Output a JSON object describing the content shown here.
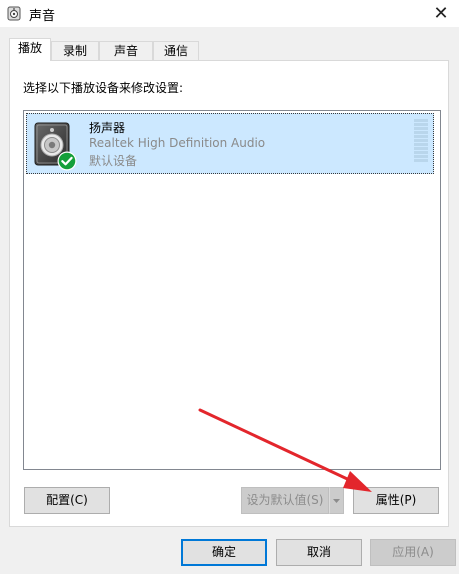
{
  "window": {
    "title": "声音"
  },
  "tabs": [
    {
      "label": "播放"
    },
    {
      "label": "录制"
    },
    {
      "label": "声音"
    },
    {
      "label": "通信"
    }
  ],
  "instruction": "选择以下播放设备来修改设置:",
  "device": {
    "name": "扬声器",
    "description": "Realtek High Definition Audio",
    "status": "默认设备",
    "icons": [
      "speaker-icon",
      "default-check-icon"
    ]
  },
  "buttons": {
    "configure": "配置(C)",
    "set_default": "设为默认值(S)",
    "properties": "属性(P)",
    "ok": "确定",
    "cancel": "取消",
    "apply": "应用(A)"
  },
  "colors": {
    "selection": "#cce8ff",
    "accent": "#0078d7",
    "check": "#159f3a",
    "arrow": "#e3262c"
  }
}
